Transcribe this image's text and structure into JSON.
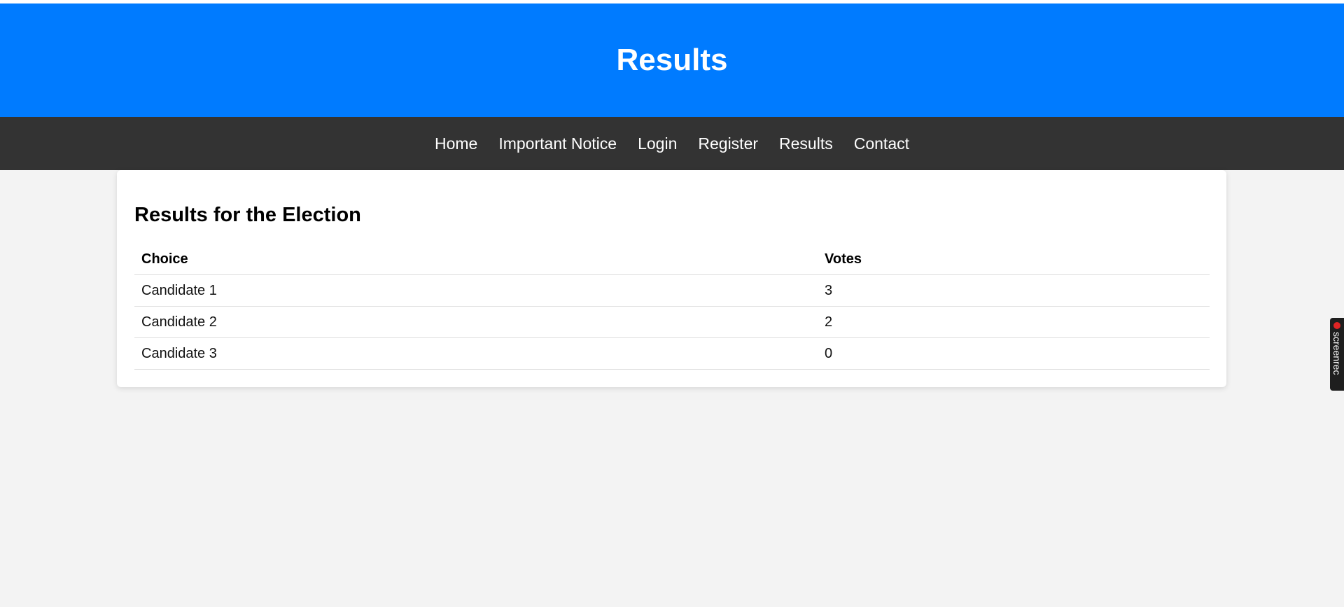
{
  "header": {
    "title": "Results",
    "color": "#007bff"
  },
  "nav": {
    "items": [
      {
        "label": "Home"
      },
      {
        "label": "Important Notice"
      },
      {
        "label": "Login"
      },
      {
        "label": "Register"
      },
      {
        "label": "Results"
      },
      {
        "label": "Contact"
      }
    ],
    "background": "#333333"
  },
  "main": {
    "heading": "Results for the Election",
    "table": {
      "columns": [
        "Choice",
        "Votes"
      ],
      "rows": [
        {
          "choice": "Candidate 1",
          "votes": "3"
        },
        {
          "choice": "Candidate 2",
          "votes": "2"
        },
        {
          "choice": "Candidate 3",
          "votes": "0"
        }
      ]
    }
  },
  "overlay": {
    "label": "screenrec",
    "icon": "record-dot-icon"
  }
}
